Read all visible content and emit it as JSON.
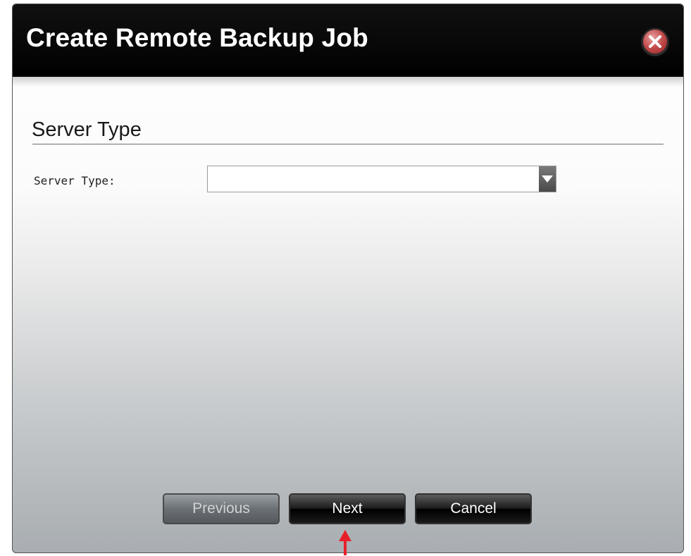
{
  "dialog": {
    "title": "Create Remote Backup Job",
    "close_icon": "close-icon"
  },
  "section": {
    "heading": "Server Type"
  },
  "form": {
    "server_type_label": "Server Type:",
    "server_type_value": "",
    "dropdown_icon": "chevron-down-icon"
  },
  "buttons": {
    "previous_label": "Previous",
    "next_label": "Next",
    "cancel_label": "Cancel"
  },
  "annotation": {
    "pointer_icon": "up-arrow-icon",
    "color": "#e8202a"
  }
}
